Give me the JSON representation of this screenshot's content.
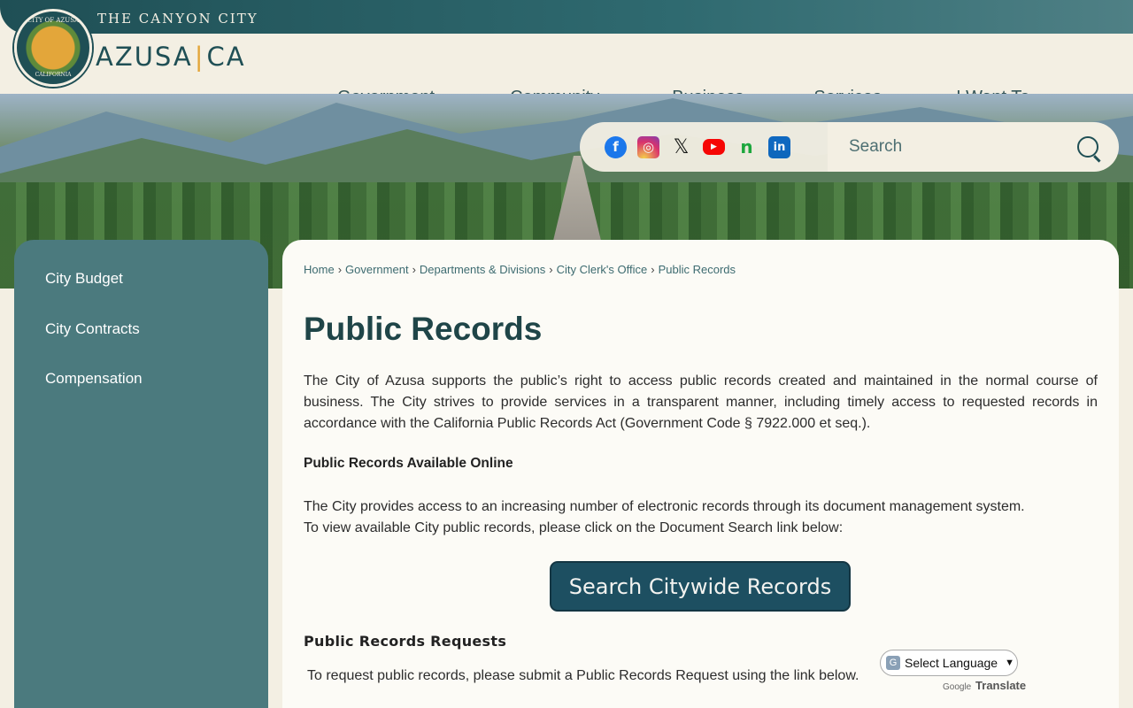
{
  "header": {
    "tagline": "THE CANYON CITY",
    "logo_main": "AZUSA",
    "logo_divider": "|",
    "logo_suffix": "CA",
    "seal_top": "CITY OF AZUSA",
    "seal_bottom": "CALIFORNIA",
    "nav": [
      "Government",
      "Community",
      "Business",
      "Services",
      "I Want To ..."
    ]
  },
  "social": {
    "icons": [
      "facebook-icon",
      "instagram-icon",
      "x-icon",
      "youtube-icon",
      "nextdoor-icon",
      "linkedin-icon"
    ],
    "glyphs": [
      "f",
      "◎",
      "𝕏",
      "▶",
      "n",
      "in"
    ]
  },
  "search": {
    "placeholder": "Search"
  },
  "sidebar": {
    "items": [
      "City Budget",
      "City Contracts",
      "Compensation"
    ]
  },
  "breadcrumb": [
    "Home",
    "Government",
    "Departments & Divisions",
    "City Clerk's Office",
    "Public Records"
  ],
  "main": {
    "title": "Public Records",
    "intro": "The City of Azusa supports the public’s right to access public records created and maintained in the normal course of business. The City strives to provide services in a transparent manner, including timely access to requested records in accordance with the California Public Records Act (Government Code § 7922.000 et seq.).",
    "online_heading": "Public Records Available Online",
    "online_line1": "The City provides access to an increasing number of electronic records through its document management system.",
    "online_line2": "To view available City public records, please click on the Document Search link below:",
    "cta_label": "Search Citywide Records",
    "requests_heading": "Public Records Requests",
    "requests_text": "To request public records, please submit a Public Records Request using the link below."
  },
  "translate": {
    "select_label": "Select Language",
    "powered_by": "Google",
    "translate_word": "Translate"
  },
  "colors": {
    "brand_teal": "#1f4f55",
    "sidebar": "#4b7a7e",
    "accent_gold": "#e3a63a",
    "cta": "#1d4f61"
  }
}
